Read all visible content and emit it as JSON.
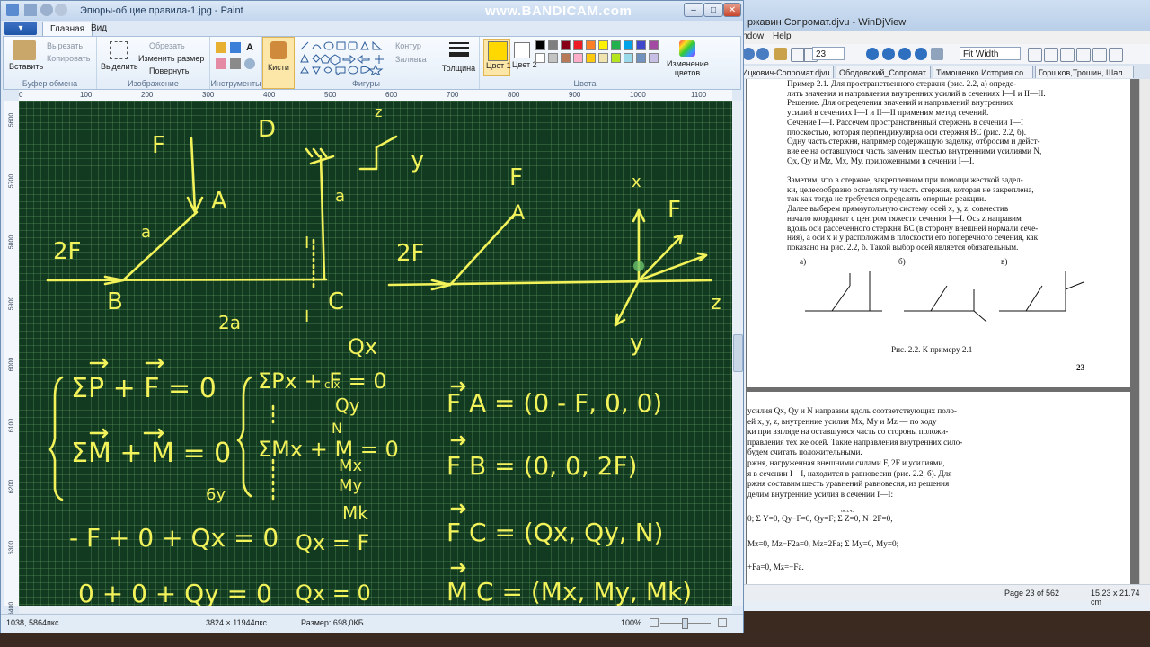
{
  "watermark": "www.BANDICAM.com",
  "paint": {
    "title": "Эпюры-общие правила-1.jpg - Paint",
    "file_tab": "▾",
    "tabs": [
      {
        "label": "Главная"
      },
      {
        "label": "Вид"
      }
    ],
    "ribbon": {
      "clipboard": {
        "paste": "Вставить",
        "cut": "Вырезать",
        "copy": "Копировать",
        "label": "Буфер обмена"
      },
      "image": {
        "select": "Выделить",
        "crop": "Обрезать",
        "resize": "Изменить размер",
        "rotate": "Повернуть",
        "label": "Изображение"
      },
      "tools": {
        "label": "Инструменты"
      },
      "brushes": {
        "label": "Кисти"
      },
      "shapes": {
        "outline": "Контур",
        "fill": "Заливка",
        "label": "Фигуры"
      },
      "size": {
        "label": "Толщина"
      },
      "color1": {
        "label": "Цвет 1",
        "value": "#ffd800"
      },
      "color2": {
        "label": "Цвет 2",
        "value": "#ffffff"
      },
      "palette": [
        "#000000",
        "#7f7f7f",
        "#880015",
        "#ed1c24",
        "#ff7f27",
        "#fff200",
        "#22b14c",
        "#00a2e8",
        "#3f48cc",
        "#a349a4",
        "#ffffff",
        "#c3c3c3",
        "#b97a57",
        "#ffaec9",
        "#ffc90e",
        "#efe4b0",
        "#b5e61d",
        "#99d9ea",
        "#7092be",
        "#c8bfe7"
      ],
      "edit_colors": "Изменение цветов",
      "colors_label": "Цвета"
    },
    "ruler_h": [
      "0",
      "100",
      "200",
      "300",
      "400",
      "500",
      "600",
      "700",
      "800",
      "900",
      "1000",
      "1100"
    ],
    "ruler_v": [
      "5600",
      "5700",
      "5800",
      "5900",
      "6000",
      "6100",
      "6200",
      "6300",
      "6400"
    ],
    "status": {
      "cursor": "1038, 5864пкс",
      "dimensions": "3824 × 11944пкс",
      "size": "Размер: 698,0КБ",
      "zoom": "100%"
    },
    "handwriting": {
      "left_diagram": [
        "F",
        "A",
        "a",
        "2F",
        "B",
        "2a",
        "C",
        "I",
        "I",
        "a",
        "D",
        "z",
        "y"
      ],
      "right_diagram": [
        "F",
        "A",
        "2F",
        "x",
        "F",
        "y",
        "z"
      ],
      "eq1": "ΣP + F = 0",
      "eq2": "ΣM + M = 0",
      "eq3": "ΣPx + F = 0",
      "eq4": "ΣMx + M = 0",
      "qx_top": "Qx",
      "qy": "Qy",
      "n": "N",
      "mx": "Mx",
      "my": "My",
      "mk": "Mk",
      "byx": "6y",
      "cx": "c x",
      "fa": "F A = (0 - F, 0, 0)",
      "fb": "F B = (0, 0, 2F)",
      "fc": "F C = (Qx, Qy, N)",
      "mc": "M C = (Mx, My, Mk)",
      "row1": "- F + 0 + Qx = 0",
      "qxf": "Qx = F",
      "qx0": "Qx = 0",
      "row2": "0 + 0 + Qy = 0"
    }
  },
  "windjview": {
    "title": "ржавин Сопромат.djvu - WinDjView",
    "menu": [
      "indow",
      "Help"
    ],
    "page_field": "23",
    "zoom_field": "Fit Width",
    "tabs": [
      "Ицкович-Сопромат.djvu",
      "Ободовский_Сопромат...",
      "Тимошенко История со...",
      "Горшков,Трошин, Шал..."
    ],
    "page1": {
      "lines": [
        "Пример 2.1. Для пространственного стержня (рис. 2.2, а) опреде-",
        "лить значения и направления внутренних усилий в сечениях I—I и II—II.",
        "Решение. Для определения значений и направлений внутренних",
        "усилий в сечениях I—I и II—II применим метод сечений.",
        "Сечение I—I. Рассечем пространственный стержень в сечении I—I",
        "плоскостью, которая перпендикулярна оси стержня BC (рис. 2.2, б).",
        "Одну часть стержня, например содержащую заделку, отбросим и дейст-",
        "вие ее на оставшуюся часть заменим шестью внутренними усилиями N,",
        "Qx, Qy и Mz, Mx, My, приложенными в сечении I—I.",
        "",
        "Заметим, что в стержне, закрепленном при помощи жесткой задел-",
        "ки, целесообразно оставлять ту часть стержня, которая не закреплена,",
        "так как тогда не требуется определять опорные реакции.",
        "Далее выберем прямоугольную систему осей x, y, z, совместив",
        "начало координат с центром тяжести сечения I—I. Ось z направим",
        "вдоль оси рассеченного стержня BC (в сторону внешней нормали сече-",
        "ния), а оси x и y расположим в плоскости его поперечного сечения, как",
        "показано на рис. 2.2, б. Такой выбор осей является обязательным."
      ],
      "fig_labels": [
        "a)",
        "б)",
        "в)"
      ],
      "caption": "Рис. 2.2. К примеру 2.1",
      "page_number": "23"
    },
    "page2": {
      "lines": [
        "усилия Qx, Qy и N направим вдоль соответствующих поло-",
        "ей x, y, z, внутренние усилия Mx, My и Mz — по ходу",
        "ки при взгляде на оставшуюся часть со стороны положи-",
        "правления тех же осей. Такие направления внутренних сило-",
        "будем считать положительными.",
        "ржня, нагруженная внешними силами F, 2F и усилиями,",
        "я в сечении I—I, находится в равновесии (рис. 2.2, б). Для",
        "ржня составим шесть уравнений равновесия, из решения",
        "делим внутренние усилия в сечении I—I:"
      ],
      "eq1": "0;  Σ Y=0, Qy−F=0, Qy=F;  Σ Z=0, N+2F=0,",
      "eq2": "Mz=0,  Mz−F2a=0,  Mz=2Fa;  Σ My=0,  My=0;",
      "eq3": "+Fa=0, Mz=−Fa.",
      "ost": "ост.ч."
    },
    "status": {
      "page": "Page 23 of 562",
      "size": "15.23 x 21.74 cm"
    }
  }
}
